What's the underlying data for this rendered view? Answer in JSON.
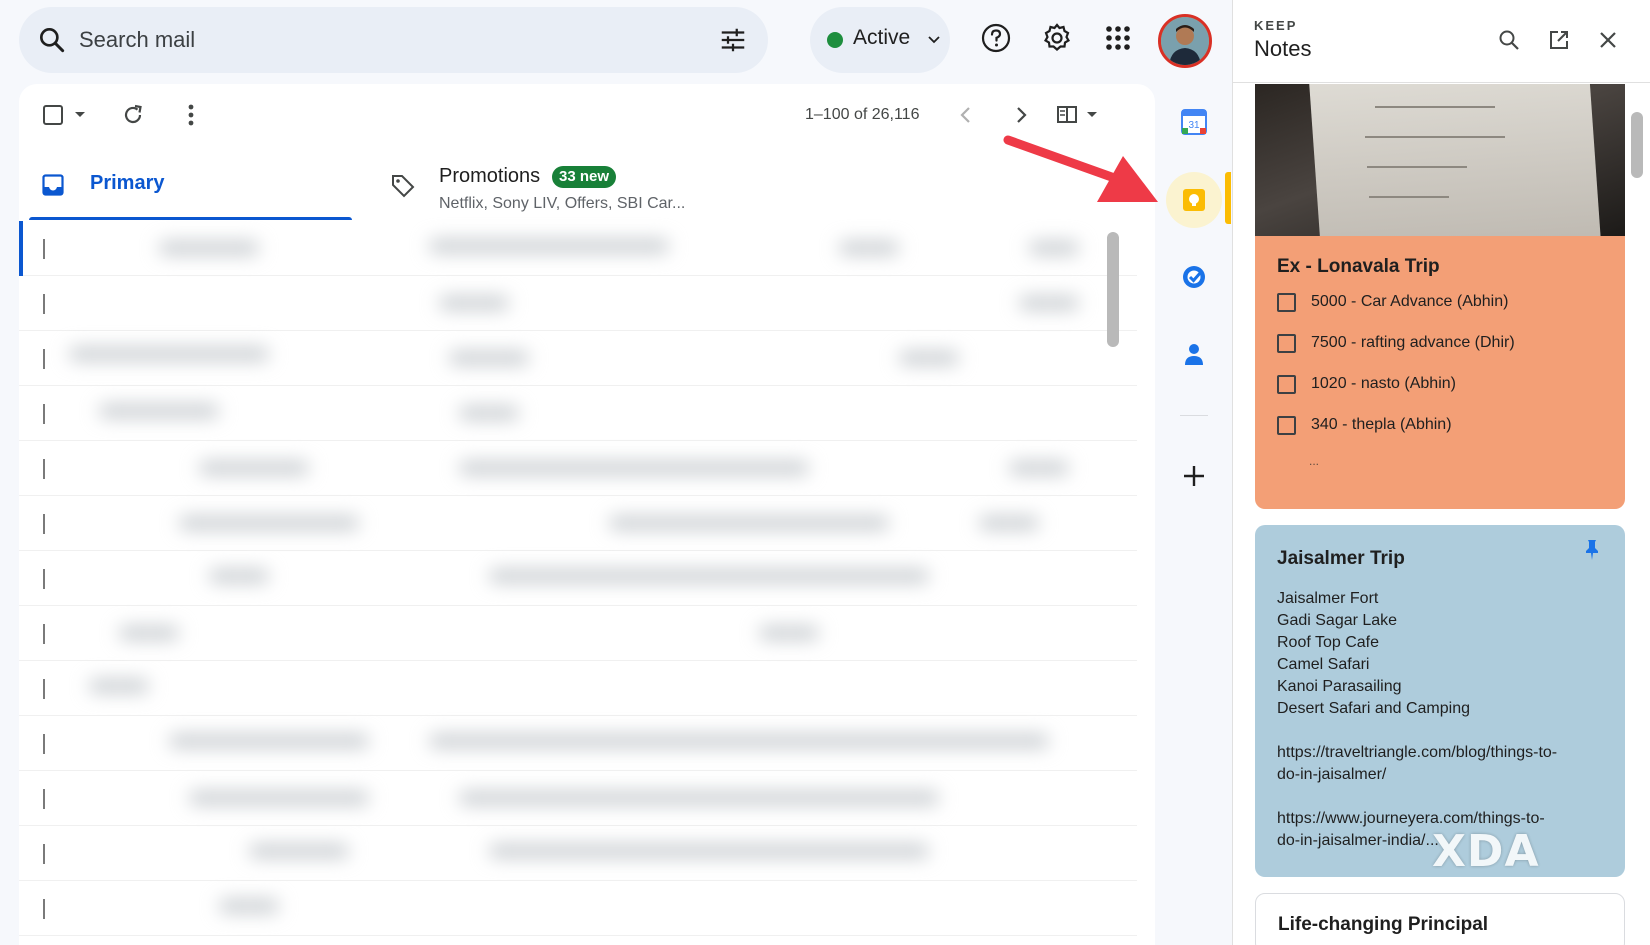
{
  "search": {
    "placeholder": "Search mail"
  },
  "status": {
    "label": "Active",
    "color": "#1e8e3e"
  },
  "toolbar": {
    "pagination": "1–100 of 26,116"
  },
  "tabs": {
    "primary": {
      "label": "Primary"
    },
    "promotions": {
      "label": "Promotions",
      "badge": "33 new",
      "snippet": "Netflix, Sony LIV, Offers, SBI Car..."
    }
  },
  "rail": {
    "calendar_day": "31"
  },
  "keep": {
    "app_label": "KEEP",
    "title": "Notes",
    "notes": [
      {
        "title": "Ex - Lonavala Trip",
        "color": "#f39f76",
        "checklist": [
          "5000 - Car Advance (Abhin)",
          "7500 - rafting advance (Dhir)",
          "1020 - nasto (Abhin)",
          "340 - thepla (Abhin)"
        ],
        "more": "..."
      },
      {
        "title": "Jaisalmer Trip",
        "color": "#aeccdc",
        "pinned": true,
        "lines": [
          "Jaisalmer Fort",
          "Gadi Sagar Lake",
          "Roof Top Cafe",
          "Camel Safari",
          "Kanoi Parasailing",
          "Desert Safari and Camping",
          "",
          "https://traveltriangle.com/blog/things-to-",
          "do-in-jaisalmer/",
          "",
          "https://www.journeyera.com/things-to-",
          "do-in-jaisalmer-india/..."
        ]
      },
      {
        "title": "Life-changing Principal",
        "color": "#ffffff"
      }
    ]
  },
  "watermark": "XDA",
  "icons": [
    "search-icon",
    "filter-icon",
    "chevron-down-icon",
    "help-icon",
    "gear-icon",
    "apps-icon",
    "avatar",
    "checkbox-icon",
    "refresh-icon",
    "more-vert-icon",
    "chevron-left-icon",
    "chevron-right-icon",
    "split-view-icon",
    "inbox-icon",
    "tag-icon",
    "calendar-icon",
    "keep-icon",
    "tasks-icon",
    "contacts-icon",
    "plus-icon",
    "close-icon",
    "open-new-window-icon",
    "pin-icon"
  ]
}
